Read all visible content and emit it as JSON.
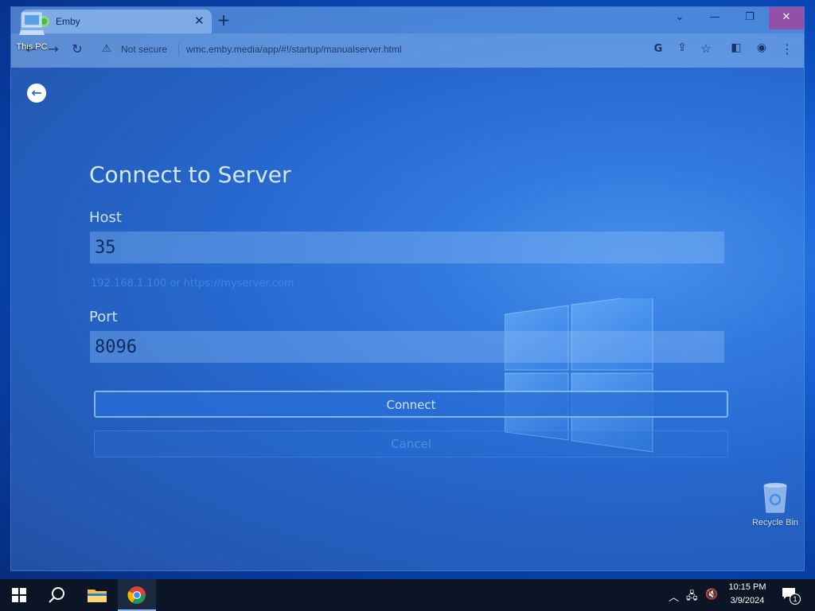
{
  "desktop": {
    "icons": [
      {
        "label": "This PC"
      },
      {
        "label": "Recycle Bin"
      }
    ]
  },
  "browser": {
    "tab": {
      "title": "Emby"
    },
    "address": {
      "security": "Not secure",
      "url": "wmc.emby.media/app/#!/startup/manualserver.html"
    }
  },
  "page": {
    "title": "Connect to Server",
    "host": {
      "label": "Host",
      "value": "35",
      "hint": "192.168.1.100 or https://myserver.com"
    },
    "port": {
      "label": "Port",
      "value": "8096"
    },
    "connect_label": "Connect",
    "cancel_label": "Cancel"
  },
  "taskbar": {
    "time": "10:15 PM",
    "date": "3/9/2024",
    "notification_count": "1"
  },
  "colors": {
    "accent": "#52b54b",
    "close_hover": "#a046a0"
  }
}
